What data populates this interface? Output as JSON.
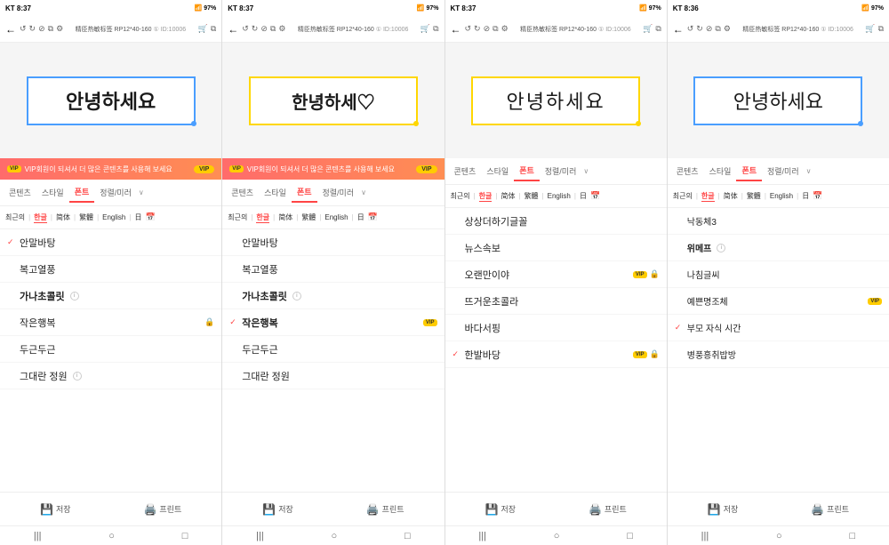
{
  "screens": [
    {
      "id": "screen1",
      "statusBar": {
        "time": "KT 8:37",
        "battery": "97%"
      },
      "topNav": {
        "backIcon": "←",
        "productLabel": "精臣热敏标签 RP12*40-160",
        "idLabel": "① ID:10006"
      },
      "previewText": "안녕하세요",
      "previewStyle": "bold",
      "borderColor": "blue",
      "vipBanner": {
        "text": "VIP회원이 되셔서 더 많은 콘텐츠를 사용해 보세요",
        "badge": "VIP"
      },
      "tabs": [
        {
          "label": "콘텐츠",
          "active": false
        },
        {
          "label": "스타일",
          "active": false
        },
        {
          "label": "폰트",
          "active": true
        },
        {
          "label": "정렬/미러",
          "active": false
        }
      ],
      "languages": [
        {
          "label": "최근의",
          "active": false
        },
        {
          "label": "한글",
          "active": true
        },
        {
          "label": "简体",
          "active": false
        },
        {
          "label": "繁體",
          "active": false
        },
        {
          "label": "English",
          "active": false
        },
        {
          "label": "日",
          "active": false
        }
      ],
      "fonts": [
        {
          "name": "안말바탕",
          "check": true,
          "style": "normal",
          "info": null,
          "lock": false,
          "vip": false
        },
        {
          "name": "복고열풍",
          "check": false,
          "style": "normal",
          "info": null,
          "lock": false,
          "vip": false
        },
        {
          "name": "가나초콜릿",
          "check": false,
          "style": "bold",
          "info": "ⓘ",
          "lock": false,
          "vip": false
        },
        {
          "name": "작은행복",
          "check": false,
          "style": "normal",
          "info": null,
          "lock": true,
          "vip": false
        },
        {
          "name": "두근두근",
          "check": false,
          "style": "normal",
          "info": null,
          "lock": false,
          "vip": false
        },
        {
          "name": "그대란 정원",
          "check": false,
          "style": "normal",
          "info": "ⓘ",
          "lock": false,
          "vip": false
        }
      ],
      "bottomBtns": [
        {
          "icon": "💾",
          "label": "저장"
        },
        {
          "icon": "🖨️",
          "label": "프린트"
        }
      ]
    },
    {
      "id": "screen2",
      "statusBar": {
        "time": "KT 8:37",
        "battery": "97%"
      },
      "topNav": {
        "backIcon": "←",
        "productLabel": "精臣热敏标签 RP12*40-160",
        "idLabel": "① ID:10006"
      },
      "previewText": "한녕하세♡",
      "previewStyle": "handwritten",
      "borderColor": "yellow",
      "vipBanner": {
        "text": "VIP회원이 되셔서 더 많은 콘텐츠를 사용해 보세요",
        "badge": "VIP"
      },
      "tabs": [
        {
          "label": "콘텐츠",
          "active": false
        },
        {
          "label": "스타일",
          "active": false
        },
        {
          "label": "폰트",
          "active": true
        },
        {
          "label": "정렬/미러",
          "active": false
        }
      ],
      "languages": [
        {
          "label": "최근의",
          "active": false
        },
        {
          "label": "한글",
          "active": true
        },
        {
          "label": "简体",
          "active": false
        },
        {
          "label": "繁體",
          "active": false
        },
        {
          "label": "English",
          "active": false
        },
        {
          "label": "日",
          "active": false
        }
      ],
      "fonts": [
        {
          "name": "안말바탕",
          "check": false,
          "style": "normal",
          "info": null,
          "lock": false,
          "vip": false
        },
        {
          "name": "복고열풍",
          "check": false,
          "style": "normal",
          "info": null,
          "lock": false,
          "vip": false
        },
        {
          "name": "가나초콜릿",
          "check": false,
          "style": "bold",
          "info": "ⓘ",
          "lock": false,
          "vip": false
        },
        {
          "name": "작은행복",
          "check": true,
          "style": "bold",
          "info": null,
          "lock": false,
          "vip": true
        },
        {
          "name": "두근두근",
          "check": false,
          "style": "normal",
          "info": null,
          "lock": false,
          "vip": false
        },
        {
          "name": "그대란 정원",
          "check": false,
          "style": "normal",
          "info": null,
          "lock": false,
          "vip": false
        }
      ],
      "bottomBtns": [
        {
          "icon": "💾",
          "label": "저장"
        },
        {
          "icon": "🖨️",
          "label": "프린트"
        }
      ]
    },
    {
      "id": "screen3",
      "statusBar": {
        "time": "KT 8:37",
        "battery": "97%"
      },
      "topNav": {
        "backIcon": "←",
        "productLabel": "精臣热敏标签 RP12*40-160",
        "idLabel": "① ID:10006"
      },
      "previewText": "안녕하세요",
      "previewStyle": "light",
      "borderColor": "yellow",
      "vipBanner": null,
      "tabs": [
        {
          "label": "콘텐츠",
          "active": false
        },
        {
          "label": "스타일",
          "active": false
        },
        {
          "label": "폰트",
          "active": true
        },
        {
          "label": "정렬/미러",
          "active": false
        }
      ],
      "languages": [
        {
          "label": "최근의",
          "active": false
        },
        {
          "label": "한글",
          "active": true
        },
        {
          "label": "简体",
          "active": false
        },
        {
          "label": "繁體",
          "active": false
        },
        {
          "label": "English",
          "active": false
        },
        {
          "label": "日",
          "active": false
        }
      ],
      "fonts": [
        {
          "name": "상상더하기글꼴",
          "check": false,
          "style": "normal",
          "info": null,
          "lock": false,
          "vip": false
        },
        {
          "name": "뉴스속보",
          "check": false,
          "style": "normal",
          "info": null,
          "lock": false,
          "vip": false
        },
        {
          "name": "오랜만이야",
          "check": false,
          "style": "normal",
          "info": null,
          "lock": true,
          "vip": true
        },
        {
          "name": "뜨거운초콜라",
          "check": false,
          "style": "normal",
          "info": null,
          "lock": false,
          "vip": false
        },
        {
          "name": "바다서핑",
          "check": false,
          "style": "normal",
          "info": null,
          "lock": false,
          "vip": false
        },
        {
          "name": "한발바당",
          "check": true,
          "style": "normal",
          "info": null,
          "lock": true,
          "vip": true
        }
      ],
      "bottomBtns": [
        {
          "icon": "💾",
          "label": "저장"
        },
        {
          "icon": "🖨️",
          "label": "프린트"
        }
      ]
    },
    {
      "id": "screen4",
      "statusBar": {
        "time": "KT 8:36",
        "battery": "97%"
      },
      "topNav": {
        "backIcon": "←",
        "productLabel": "精臣热敏标签 RP12*40-160",
        "idLabel": "① ID:10006"
      },
      "previewText": "안녕하세요",
      "previewStyle": "medium",
      "borderColor": "blue",
      "vipBanner": null,
      "tabs": [
        {
          "label": "콘텐츠",
          "active": false
        },
        {
          "label": "스타일",
          "active": false
        },
        {
          "label": "폰트",
          "active": true
        },
        {
          "label": "정렬/미러",
          "active": false
        }
      ],
      "languages": [
        {
          "label": "최근의",
          "active": false
        },
        {
          "label": "한글",
          "active": true
        },
        {
          "label": "简体",
          "active": false
        },
        {
          "label": "繁體",
          "active": false
        },
        {
          "label": "English",
          "active": false
        },
        {
          "label": "日",
          "active": false
        }
      ],
      "fonts": [
        {
          "name": "낙동체3",
          "check": false,
          "style": "normal",
          "info": null,
          "lock": false,
          "vip": false
        },
        {
          "name": "위메프",
          "check": false,
          "style": "bold",
          "info": "ⓘ",
          "lock": false,
          "vip": false
        },
        {
          "name": "나침글씨",
          "check": false,
          "style": "normal",
          "info": null,
          "lock": false,
          "vip": false
        },
        {
          "name": "예쁜명조체",
          "check": false,
          "style": "normal",
          "info": null,
          "lock": false,
          "vip": true
        },
        {
          "name": "부모 자식 시간",
          "check": true,
          "style": "normal",
          "info": null,
          "lock": false,
          "vip": false
        },
        {
          "name": "병풍흥취밥방",
          "check": false,
          "style": "normal",
          "info": null,
          "lock": false,
          "vip": false
        }
      ],
      "bottomBtns": [
        {
          "icon": "💾",
          "label": "저장"
        },
        {
          "icon": "🖨️",
          "label": "프린트"
        }
      ]
    }
  ]
}
